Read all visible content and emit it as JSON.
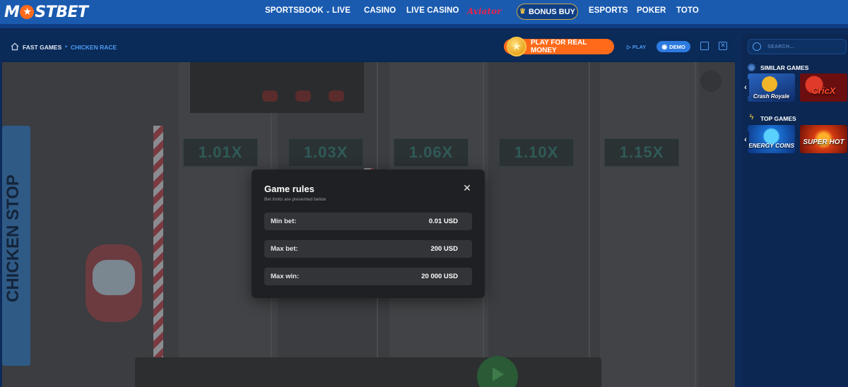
{
  "header": {
    "logo_left": "M",
    "logo_star": "★",
    "logo_right": "STBET",
    "nav": [
      {
        "label": "SPORTSBOOK",
        "chevron": "⌄"
      },
      {
        "label": "LIVE"
      },
      {
        "label": "CASINO"
      },
      {
        "label": "LIVE CASINO"
      },
      {
        "label": "Aviator"
      },
      {
        "label": "BONUS BUY"
      },
      {
        "label": "ESPORTS"
      },
      {
        "label": "POKER"
      },
      {
        "label": "TOTO"
      }
    ]
  },
  "breadcrumb": {
    "items": [
      "FAST GAMES",
      "CHICKEN RACE"
    ],
    "separator": "•",
    "home_icon": "home-icon"
  },
  "toolbar": {
    "real_money_label": "PLAY FOR REAL MONEY",
    "play_label": "PLAY",
    "play_icon": "▷",
    "demo_label": "DEMO",
    "demo_icon": "eye-icon",
    "accent": "#ff6a1a",
    "link_color": "#4f9cf1"
  },
  "game": {
    "multipliers": [
      "1.01X",
      "1.03X",
      "1.06X",
      "1.10X",
      "1.15X"
    ],
    "sign_text": "CHICKEN STOP"
  },
  "modal": {
    "title": "Game rules",
    "subtitle": "Bet limits are presented below",
    "close_icon": "✕",
    "rows": [
      {
        "label": "Min bet:",
        "value": "0.01 USD"
      },
      {
        "label": "Max bet:",
        "value": "200 USD"
      },
      {
        "label": "Max win:",
        "value": "20 000 USD"
      }
    ]
  },
  "sidebar": {
    "search_placeholder": "SEARCH...",
    "similar_title": "SIMILAR GAMES",
    "top_title": "TOP GAMES",
    "similar_games": [
      {
        "name": "Crash Royale",
        "color": "#1c4f9a"
      },
      {
        "name": "CricX",
        "color": "#8a1a1a"
      }
    ],
    "top_games": [
      {
        "name": "ENERGY COINS",
        "color": "#1a6fd1"
      },
      {
        "name": "SUPER HOT",
        "color": "#b32a10"
      }
    ],
    "arrow": "‹"
  }
}
